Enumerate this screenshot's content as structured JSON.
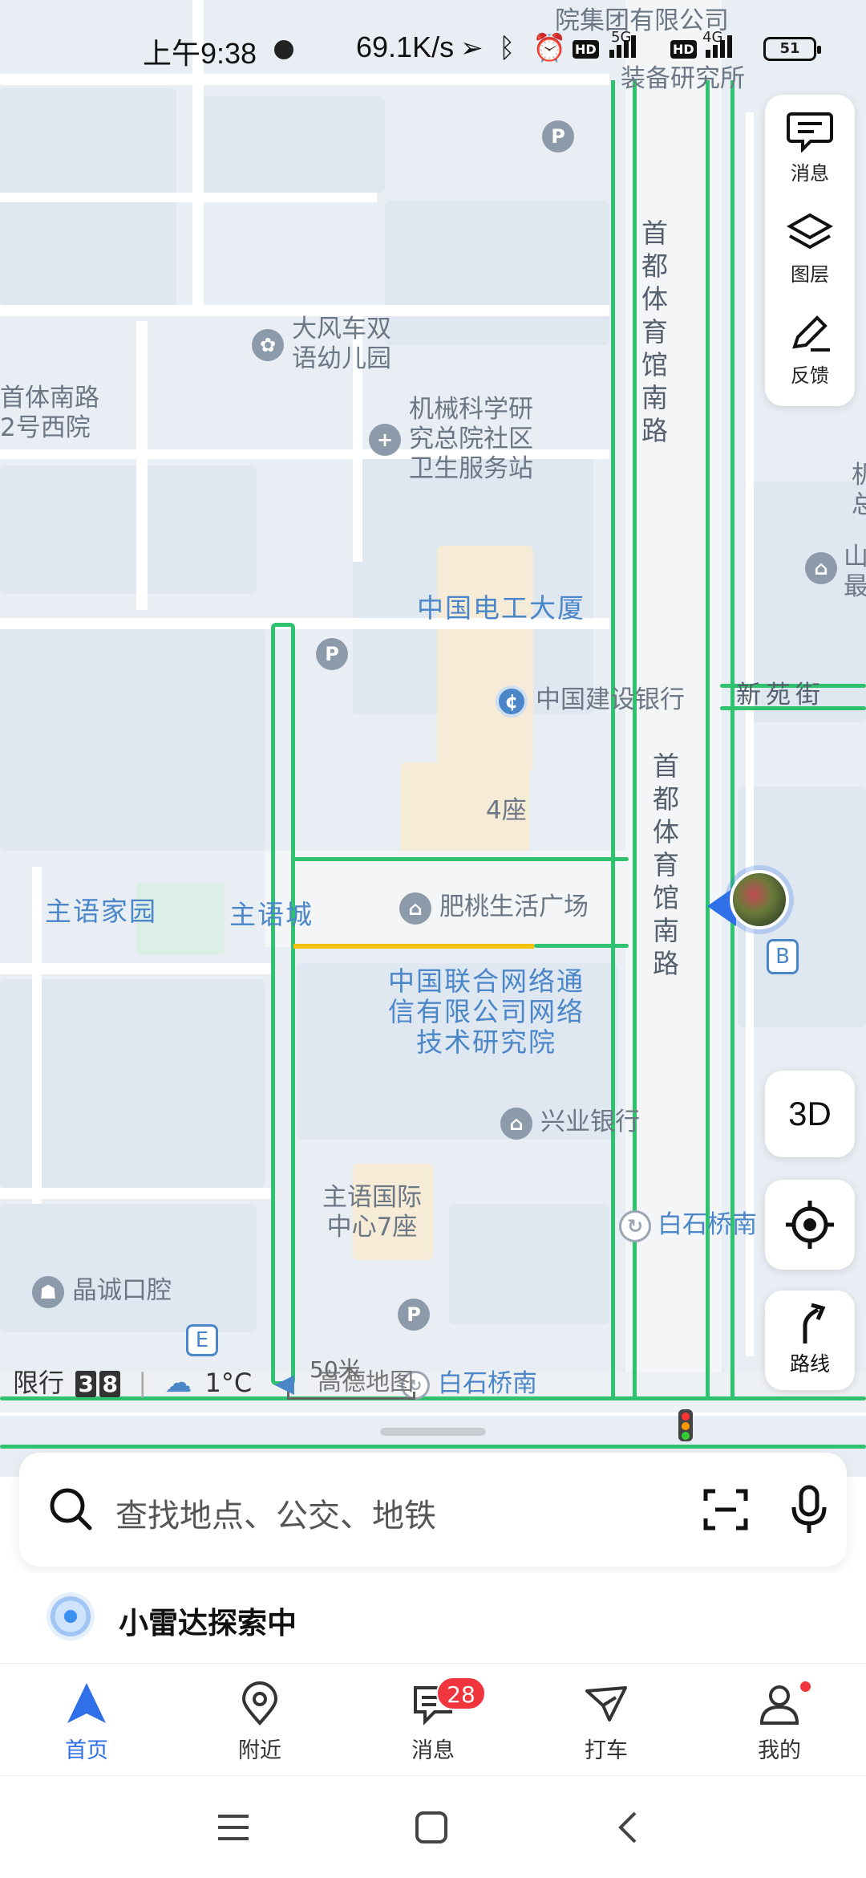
{
  "status_bar": {
    "time": "上午9:38",
    "net_speed": "69.1K/s",
    "signal1_label": "5G",
    "signal2_label": "4G",
    "hd": "HD",
    "battery": "51"
  },
  "map": {
    "labels": {
      "top_company": "院集团有限公司",
      "top_institute": "装备研究所",
      "kindergarten": "大风车双\n语幼儿园",
      "west_road": "首体南路\n2号西院",
      "clinic": "机械科学研\n究总院社区\n卫生服务站",
      "street_north": "首都体育馆南路",
      "street_south": "首都体育馆南路",
      "building_dianGong": "中国电工大厦",
      "ccb": "中国建设银行",
      "xinyuan": "新苑街",
      "zuo4": "4座",
      "zhuyu_home": "主语家园",
      "zhuyu_city": "主语城",
      "feitao": "肥桃生活广场",
      "unicom": "中国联合网络通\n信有限公司网络\n技术研究院",
      "xingye": "兴业银行",
      "zhuyu_intl": "主语国际\n中心7座",
      "baishiqiao_n": "白石桥南",
      "baishiqiao_s": "白石桥南",
      "jingcheng": "晶诚口腔",
      "right_edge_1": "山\n最",
      "right_edge_2": "机\n总",
      "entrance_e": "E",
      "entrance_b": "B",
      "watermark": "高德地图",
      "scale": "50米"
    },
    "info_line": {
      "restriction_label": "限行",
      "plate1": "3",
      "plate2": "8",
      "temperature": "1°C"
    }
  },
  "side_panel": {
    "messages": "消息",
    "layers": "图层",
    "feedback": "反馈"
  },
  "floating": {
    "three_d": "3D",
    "route": "路线"
  },
  "search": {
    "placeholder": "查找地点、公交、地铁"
  },
  "radar": {
    "text": "小雷达探索中"
  },
  "tabs": {
    "home": "首页",
    "nearby": "附近",
    "messages": "消息",
    "messages_badge": "28",
    "taxi": "打车",
    "mine": "我的"
  },
  "colors": {
    "accent": "#2f6fe8",
    "route_green": "#2fc36f",
    "badge_red": "#f0353d",
    "map_label_blue": "#4a86c8"
  }
}
